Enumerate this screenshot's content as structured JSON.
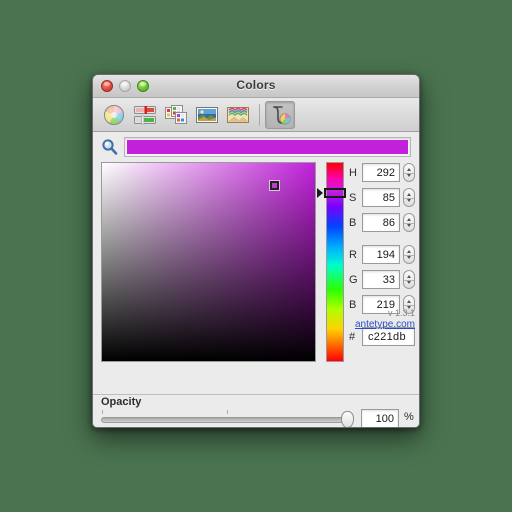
{
  "window": {
    "title": "Colors",
    "controls": {
      "close": "close",
      "minimize": "minimize",
      "zoom": "zoom"
    }
  },
  "toolbar": {
    "items": [
      {
        "name": "color-wheel",
        "label": "Color Wheel",
        "selected": false
      },
      {
        "name": "color-sliders",
        "label": "Color Sliders",
        "selected": false
      },
      {
        "name": "color-palettes",
        "label": "Color Palettes",
        "selected": false
      },
      {
        "name": "image-palettes",
        "label": "Image Palettes",
        "selected": false
      },
      {
        "name": "crayons",
        "label": "Crayons",
        "selected": false
      },
      {
        "name": "antetype-picker",
        "label": "Antetype Color Picker",
        "selected": true
      }
    ]
  },
  "search": {
    "icon": "magnifier-icon",
    "placeholder": "",
    "value": ""
  },
  "color": {
    "hex_display": "c221db",
    "css": "#c221db",
    "swatch_label": "Current color swatch"
  },
  "picker": {
    "marker_left_pct": 79,
    "marker_top_pct": 9,
    "hue_marker_top_pct": 13
  },
  "fields": {
    "hsb": [
      {
        "label": "H",
        "value": "292",
        "name": "hue-field"
      },
      {
        "label": "S",
        "value": "85",
        "name": "saturation-field"
      },
      {
        "label": "B",
        "value": "86",
        "name": "brightness-field"
      }
    ],
    "rgb": [
      {
        "label": "R",
        "value": "194",
        "name": "red-field"
      },
      {
        "label": "G",
        "value": "33",
        "name": "green-field"
      },
      {
        "label": "B",
        "value": "219",
        "name": "blue-field"
      }
    ],
    "hex": {
      "label": "#",
      "value": "c221db",
      "name": "hex-field"
    }
  },
  "footer": {
    "version": "v 1.3.1",
    "link": "antetype.com"
  },
  "opacity": {
    "label": "Opacity",
    "value": "100",
    "unit": "%",
    "slider_pct": 100
  },
  "colors": {
    "accent": "#c221db",
    "desktop_background": "#4a7450",
    "link": "#2b4ec4"
  }
}
